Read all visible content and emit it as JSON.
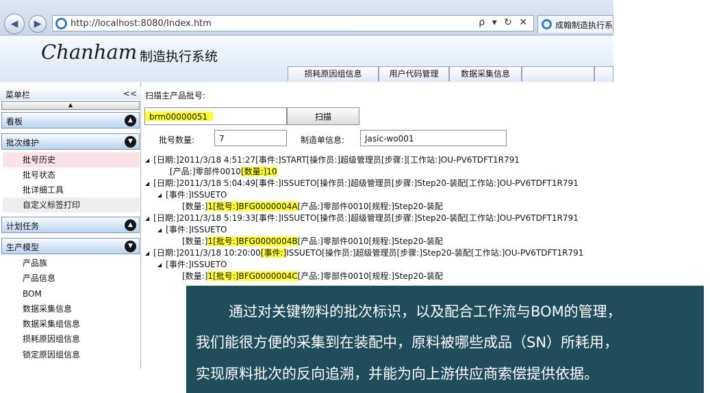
{
  "browser": {
    "url": "http://localhost:8080/Index.htm",
    "tools": "ρ ▾ ↻ ✕",
    "tab_title": "成翰制造执行系"
  },
  "header": {
    "logo": "Chanham",
    "title": "制造执行系统",
    "tabs": [
      "损耗原因组信息",
      "用户代码管理",
      "数据采集信息",
      "",
      ""
    ]
  },
  "sidebar": {
    "title": "菜单栏",
    "collapse": "<<",
    "scroll_up": "▲",
    "sections": {
      "kanban": "看板",
      "batch": "批次维护",
      "plan": "计划任务",
      "model": "生产模型"
    },
    "batch_items": [
      "批号历史",
      "批号状态",
      "批详细工具",
      "自定义标签打印"
    ],
    "model_items": [
      "产品族",
      "产品信息",
      "BOM",
      "数据采集信息",
      "数据采集组信息",
      "损耗原因组信息",
      "锁定原因组信息"
    ]
  },
  "main": {
    "scan_label": "扫描主产品批号:",
    "scan_value": "brm00000051",
    "scan_button": "扫描",
    "batch_count_label": "批号数量:",
    "batch_count": "7",
    "order_label": "制造单信息:",
    "order_value": "Jasic-wo001"
  },
  "tree": {
    "l1a": "[日期:]2011/3/18 4:51:27[事件:]START[操作员:]超级管理员[步骤:][工作站:]OU-PV6TDFT1R791",
    "l2a": "[产品:]零部件0010",
    "l2b": "[数量:]10",
    "l3": "[日期:]2011/3/18 5:04:49[事件:]ISSUETO[操作员:]超级管理员[步骤:]Step20-装配[工作站:]OU-PV6TDFT1R791",
    "l4": "[事件:]ISSUETO",
    "l5a": "[数量:]",
    "l5b": "1[批号:]BFG0000004A",
    "l5c": "[产品:]零部件0010[规程:]Step20-装配",
    "l6": "[日期:]2011/3/18 5:19:33[事件:]ISSUETO[操作员:]超级管理员[步骤:]Step20-装配[工作站:]OU-PV6TDFT1R791",
    "l7": "[事件:]ISSUETO",
    "l8a": "[数量:]",
    "l8b": "1[批号:]BFG0000004B",
    "l8c": "[产品:]零部件0010[规程:]Step20-装配",
    "l9a": "[日期:]2011/3/18 10:20:00",
    "l9b": "[事件:]",
    "l9c": "ISSUETO[操作员:]超级管理员[步骤:]Step20-装配[工作站:]OU-PV6TDFT1R791",
    "l10": "[事件:]ISSUETO",
    "l11a": "[数量:]",
    "l11b": "1[批号:]BFG0000004C",
    "l11c": "[产品:]零部件0010[规程:]Step20-装配"
  },
  "caption": {
    "line1": "通过对关键物料的批次标识，以及配合工作流与BOM的管理，",
    "line2": "我们能很方便的采集到在装配中，原料被哪些成品（SN）所耗用，",
    "line3": "实现原料批次的反向追溯，并能为向上游供应商索偿提供依据。"
  }
}
